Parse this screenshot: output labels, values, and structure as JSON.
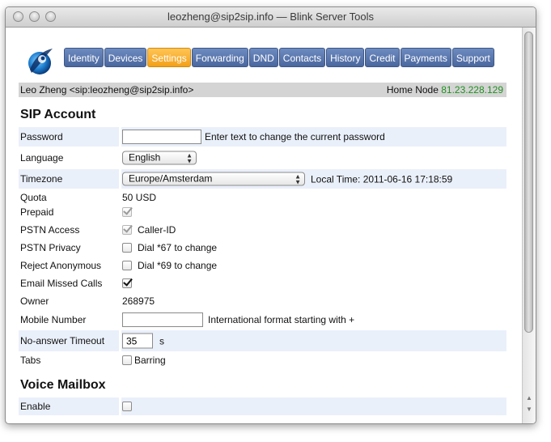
{
  "window": {
    "title": "leozheng@sip2sip.info — Blink Server Tools"
  },
  "nav": {
    "tabs": [
      {
        "label": "Identity",
        "active": false
      },
      {
        "label": "Devices",
        "active": false
      },
      {
        "label": "Settings",
        "active": true
      },
      {
        "label": "Forwarding",
        "active": false
      },
      {
        "label": "DND",
        "active": false
      },
      {
        "label": "Contacts",
        "active": false
      },
      {
        "label": "History",
        "active": false
      },
      {
        "label": "Credit",
        "active": false
      },
      {
        "label": "Payments",
        "active": false
      },
      {
        "label": "Support",
        "active": false
      }
    ]
  },
  "info": {
    "user": "Leo Zheng <sip:leozheng@sip2sip.info>",
    "home_node_label": "Home Node",
    "home_node_ip": "81.23.228.129"
  },
  "sip_account": {
    "heading": "SIP Account",
    "password": {
      "label": "Password",
      "value": "",
      "hint": "Enter text to change the current password"
    },
    "language": {
      "label": "Language",
      "selected": "English"
    },
    "timezone": {
      "label": "Timezone",
      "selected": "Europe/Amsterdam",
      "local_time": "Local Time: 2011-06-16 17:18:59"
    },
    "quota": {
      "label": "Quota",
      "value": "50 USD"
    },
    "prepaid": {
      "label": "Prepaid",
      "checked": true
    },
    "pstn_access": {
      "label": "PSTN Access",
      "checked": true,
      "option": "Caller-ID"
    },
    "pstn_privacy": {
      "label": "PSTN Privacy",
      "checked": false,
      "option": "Dial *67 to change"
    },
    "reject_anonymous": {
      "label": "Reject Anonymous",
      "checked": false,
      "option": "Dial *69 to change"
    },
    "email_missed_calls": {
      "label": "Email Missed Calls",
      "checked": true
    },
    "owner": {
      "label": "Owner",
      "value": "268975"
    },
    "mobile_number": {
      "label": "Mobile Number",
      "value": "",
      "hint": "International format starting with +"
    },
    "no_answer_timeout": {
      "label": "No-answer Timeout",
      "value": "35",
      "unit": "s"
    },
    "tabs": {
      "label": "Tabs",
      "checked": false,
      "option": "Barring"
    }
  },
  "voice_mailbox": {
    "heading": "Voice Mailbox",
    "enable": {
      "label": "Enable",
      "checked": false
    }
  }
}
